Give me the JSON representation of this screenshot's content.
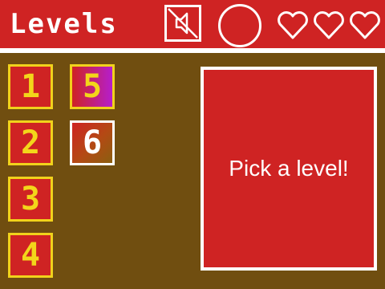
{
  "header": {
    "title": "Levels",
    "sound_icon": "speaker-muted-icon",
    "extra_icon": "circle-icon",
    "lives": {
      "count": 3,
      "icon": "heart-outline-icon"
    }
  },
  "levels": [
    {
      "label": "1",
      "state": "normal"
    },
    {
      "label": "2",
      "state": "normal"
    },
    {
      "label": "3",
      "state": "normal"
    },
    {
      "label": "4",
      "state": "normal"
    },
    {
      "label": "5",
      "state": "highlighted"
    },
    {
      "label": "6",
      "state": "selected"
    }
  ],
  "panel": {
    "message": "Pick a level!"
  },
  "colors": {
    "primary_red": "#cf2323",
    "board_brown": "#704e10",
    "level_yellow": "#f3d61a",
    "highlight_magenta": "#b51ecd",
    "white": "#ffffff"
  }
}
